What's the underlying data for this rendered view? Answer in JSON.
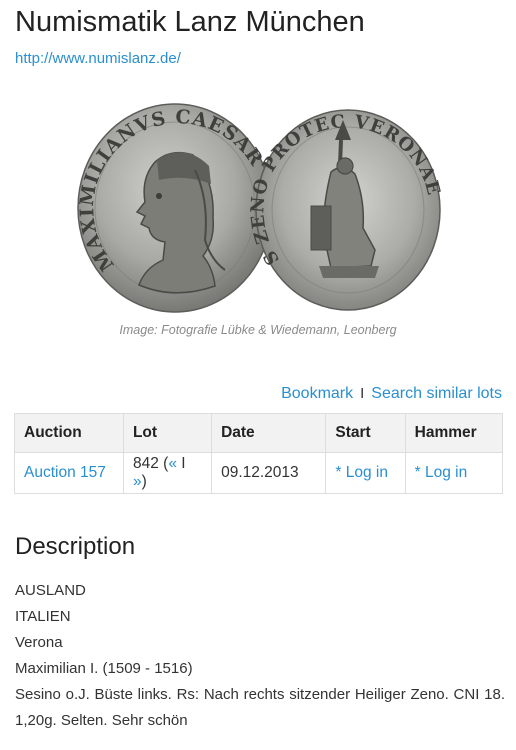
{
  "header": {
    "title": "Numismatik Lanz München",
    "url": "http://www.numislanz.de/"
  },
  "image": {
    "obverse_legend": "MAXIMILIANVS CAESAR",
    "reverse_legend": "S ZENO PROTEC VERONAE",
    "caption": "Image: Fotografie Lübke & Wiedemann, Leonberg"
  },
  "actions": {
    "bookmark": "Bookmark",
    "separator": "I",
    "search_similar": "Search similar lots"
  },
  "table": {
    "headers": [
      "Auction",
      "Lot",
      "Date",
      "Start",
      "Hammer"
    ],
    "row": {
      "auction": "Auction 157",
      "lot_number": "842",
      "lot_open": "(",
      "prev": "«",
      "lot_sep": "I",
      "next": "»",
      "lot_close": ")",
      "date": "09.12.2013",
      "start": "* Log in",
      "hammer": "* Log in"
    }
  },
  "description": {
    "heading": "Description",
    "lines": [
      "AUSLAND",
      "ITALIEN",
      "Verona",
      "Maximilian I. (1509 - 1516)",
      "Sesino o.J. Büste links. Rs: Nach rechts sitzender Heiliger Zeno. CNI 18. 1,20g. Selten. Sehr schön"
    ]
  },
  "colors": {
    "link": "#2a8fd0",
    "coin_silver": "#a9a9a5",
    "coin_dark": "#4a4a46"
  }
}
